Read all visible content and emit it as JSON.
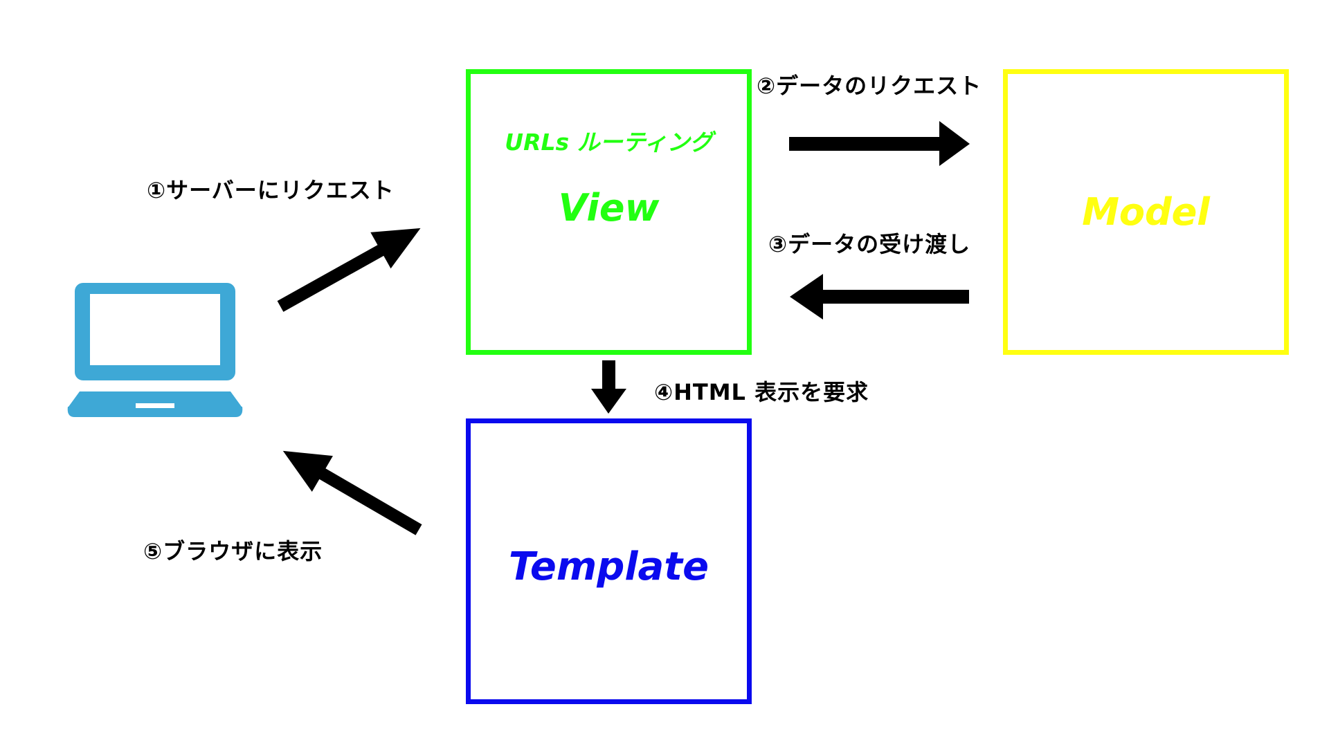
{
  "view": {
    "subtitle": "URLs ルーティング",
    "title": "View",
    "color": "#22ff11"
  },
  "model": {
    "title": "Model",
    "color": "#ffff11"
  },
  "template": {
    "title": "Template",
    "color": "#0a0aee"
  },
  "steps": [
    "①サーバーにリクエスト",
    "②データのリクエスト",
    "③データの受け渡し",
    "④HTML 表示を要求",
    "⑤ブラウザに表示"
  ],
  "icons": {
    "client": "laptop-icon",
    "client_color": "#3ea8d6",
    "arrow_color": "#000000"
  }
}
